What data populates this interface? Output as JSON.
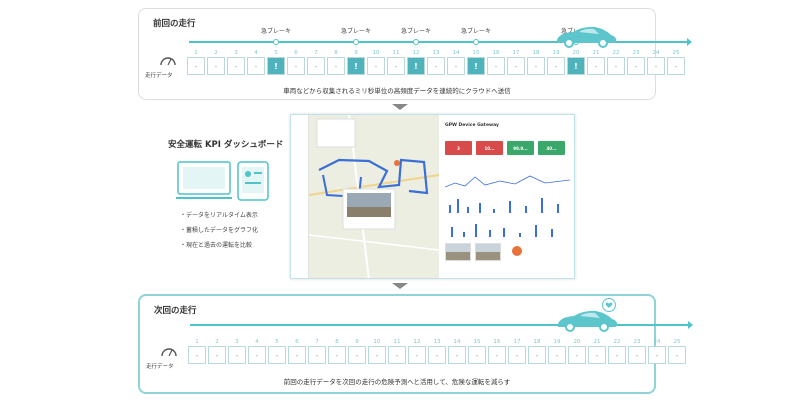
{
  "top_panel": {
    "title": "前回の走行",
    "brake_label": "急ブレーキ",
    "brake_cells": [
      5,
      9,
      12,
      15,
      20
    ],
    "cells": [
      "1",
      "2",
      "3",
      "4",
      "5",
      "6",
      "7",
      "8",
      "9",
      "10",
      "11",
      "12",
      "13",
      "14",
      "15",
      "16",
      "17",
      "18",
      "19",
      "20",
      "21",
      "22",
      "23",
      "24",
      "25"
    ],
    "empty_mark": "-",
    "alert_mark": "!",
    "gauge_label": "走行データ",
    "caption": "車両などから収集されるミリ秒単位の高頻度データを連続的にクラウドへ送信"
  },
  "dashboard": {
    "title": "安全運転 KPI ダッシュボード",
    "bullets": [
      "・データをリアルタイム表示",
      "・蓄積したデータをグラフ化",
      "・現在と過去の運転を比較"
    ],
    "screen_title": "GPW Device Gateway",
    "stats": [
      {
        "value": "3",
        "color": "#d94b4b"
      },
      {
        "value": "10...",
        "color": "#d94b4b"
      },
      {
        "value": "99.9...",
        "color": "#3aa86a"
      },
      {
        "value": "40...",
        "color": "#3aa86a"
      }
    ]
  },
  "bottom_panel": {
    "title": "次回の走行",
    "cells": [
      "1",
      "2",
      "3",
      "4",
      "5",
      "6",
      "7",
      "8",
      "9",
      "10",
      "11",
      "12",
      "13",
      "14",
      "15",
      "16",
      "17",
      "18",
      "19",
      "20",
      "21",
      "22",
      "23",
      "24",
      "25"
    ],
    "empty_mark": "-",
    "gauge_label": "走行データ",
    "caption": "前回の走行データを次回の走行の危険予測へと活用して、危険な運転を減らす"
  },
  "colors": {
    "accent": "#4ec3c9",
    "alert": "#4fb3bb",
    "car": "#5cc6cc"
  }
}
